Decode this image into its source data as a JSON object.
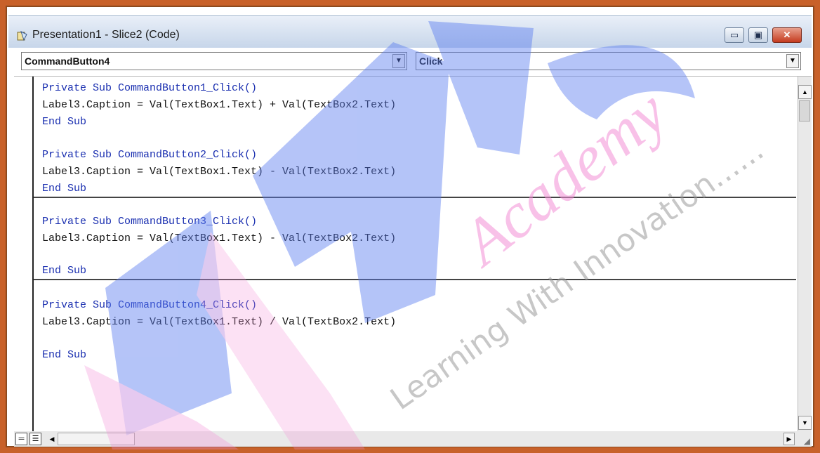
{
  "window": {
    "title": "Presentation1 - Slice2 (Code)",
    "minimize_glyph": "▭",
    "maximize_glyph": "▣",
    "close_glyph": "✕"
  },
  "object_dropdown": {
    "value": "CommandButton4",
    "arrow": "▼"
  },
  "procedure_dropdown": {
    "value": "Click",
    "arrow": "▼"
  },
  "code": {
    "block1": {
      "sub": "Private Sub CommandButton1_Click()",
      "body": "Label3.Caption = Val(TextBox1.Text) + Val(TextBox2.Text)",
      "end": "End Sub"
    },
    "block2": {
      "sub": "Private Sub CommandButton2_Click()",
      "body": "Label3.Caption = Val(TextBox1.Text) - Val(TextBox2.Text)",
      "end": "End Sub"
    },
    "block3": {
      "sub": "Private Sub CommandButton3_Click()",
      "body": "Label3.Caption = Val(TextBox1.Text) - Val(TextBox2.Text)",
      "end": "End Sub"
    },
    "block4": {
      "sub": "Private Sub CommandButton4_Click()",
      "body": "Label3.Caption = Val(TextBox1.Text) / Val(TextBox2.Text)",
      "end": "End Sub"
    }
  },
  "watermark": {
    "script": "Academy",
    "tagline": "Learning With Innovation......"
  },
  "colors": {
    "keyword": "#1a2fb0",
    "watermark_blue": "#5b7df0",
    "watermark_pink": "#f48fd6"
  }
}
